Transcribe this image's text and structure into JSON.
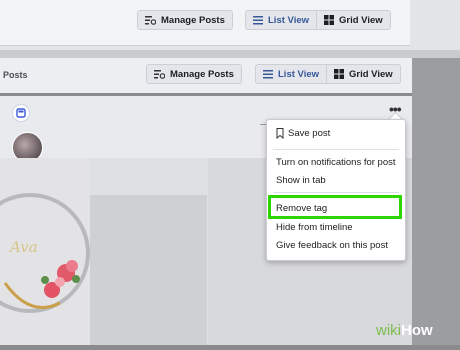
{
  "top_toolbar": {
    "manage_posts": "Manage Posts",
    "list_view": "List View",
    "grid_view": "Grid View"
  },
  "posts_section": {
    "title": "Posts",
    "manage_posts": "Manage Posts",
    "list_view": "List View",
    "grid_view": "Grid View"
  },
  "post": {
    "options": "•••",
    "photo_caption": "Ava"
  },
  "menu": {
    "items": [
      "Save post",
      "Turn on notifications for post",
      "Show in tab",
      "Remove tag",
      "Hide from timeline",
      "Give feedback on this post"
    ],
    "highlighted_item": "Remove tag"
  },
  "watermark": {
    "wiki": "wiki",
    "how": "How"
  },
  "colors": {
    "highlight": "#2dd600",
    "active_view": "#385898"
  }
}
